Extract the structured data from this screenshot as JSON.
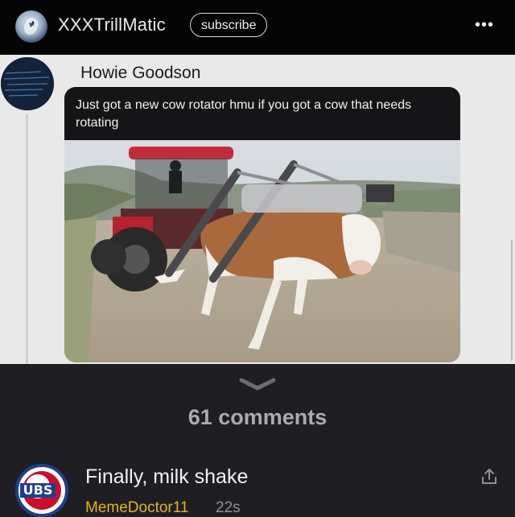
{
  "header": {
    "username": "XXXTrillMatic",
    "subscribe_label": "subscribe",
    "more_label": "•••"
  },
  "post": {
    "author": "Howie Goodson",
    "text": "Just got a new cow rotator hmu if you got a cow that needs rotating"
  },
  "comments": {
    "count_label": "61 comments",
    "items": [
      {
        "text": "Finally, milk shake",
        "user": "MemeDoctor11",
        "time": "22s",
        "avatar_text": "UBS"
      }
    ]
  },
  "colors": {
    "top_bar": "#050505",
    "background": "#1f1f23",
    "post_bg": "#e9e9ea",
    "bubble": "#151517",
    "username_accent": "#e3b321"
  }
}
